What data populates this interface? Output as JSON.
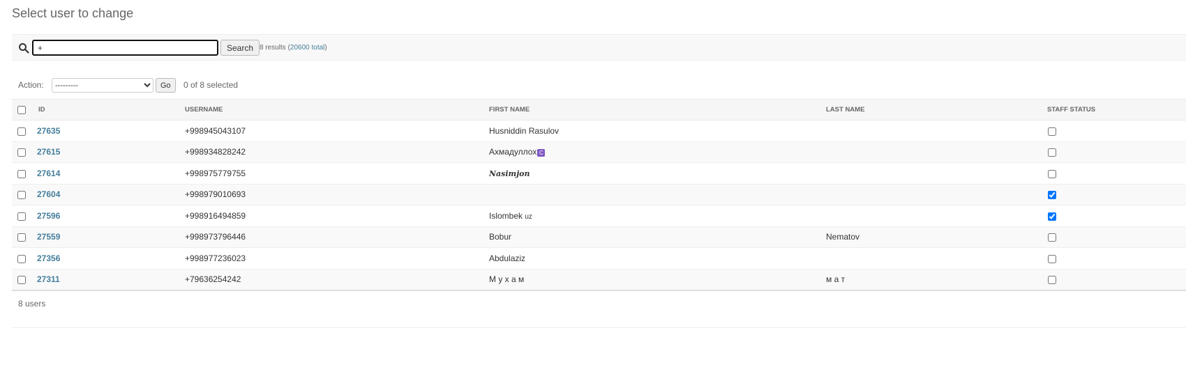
{
  "page": {
    "title": "Select user to change"
  },
  "search": {
    "value": "+",
    "button_label": "Search",
    "results_prefix": "8 results (",
    "total_link": "20600 total",
    "results_suffix": ")"
  },
  "actions": {
    "label": "Action:",
    "selected_option": "---------",
    "go_label": "Go",
    "selected_count": "0 of 8 selected"
  },
  "table": {
    "columns": {
      "id": "ID",
      "username": "USERNAME",
      "first_name": "FIRST NAME",
      "last_name": "LAST NAME",
      "staff_status": "STAFF STATUS"
    },
    "rows": [
      {
        "id": "27635",
        "username": "+998945043107",
        "first_name": "Husniddin Rasulov",
        "last_name": "",
        "staff": false
      },
      {
        "id": "27615",
        "username": "+998934828242",
        "first_name": "Ахмадуллох",
        "first_name_badge": "C",
        "last_name": "",
        "staff": false
      },
      {
        "id": "27614",
        "username": "+998975779755",
        "first_name": "Nasimjon",
        "last_name": "",
        "staff": false
      },
      {
        "id": "27604",
        "username": "+998979010693",
        "first_name": "",
        "last_name": "",
        "staff": true
      },
      {
        "id": "27596",
        "username": "+998916494859",
        "first_name": "Islombek",
        "first_name_suffix": "uz",
        "last_name": "",
        "staff": true
      },
      {
        "id": "27559",
        "username": "+998973796446",
        "first_name": "Bobur",
        "last_name": "Nematov",
        "staff": false
      },
      {
        "id": "27356",
        "username": "+998977236023",
        "first_name": "Abdulaziz",
        "last_name": "",
        "staff": false
      },
      {
        "id": "27311",
        "username": "+79636254242",
        "first_name": "М у х а м",
        "last_name": "м а т",
        "staff": false
      }
    ]
  },
  "paginator": {
    "text": "8 users"
  },
  "colors": {
    "link": "#447e9b",
    "badge": "#7e57c2"
  }
}
